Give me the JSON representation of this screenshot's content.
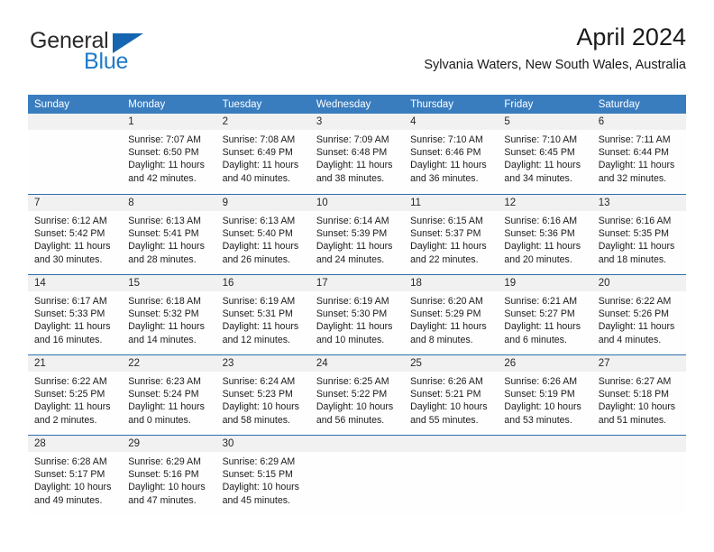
{
  "brand": {
    "name_top": "General",
    "name_bottom": "Blue",
    "triangle_color": "#1565b0",
    "blue_text_color": "#1f79c9"
  },
  "header": {
    "title": "April 2024",
    "subtitle": "Sylvania Waters, New South Wales, Australia",
    "header_bg_color": "#3a7dbf",
    "header_text_color": "#ffffff",
    "daynum_band_color": "#f1f1f1",
    "row_divider_color": "#2f6fae"
  },
  "weekdays": [
    "Sunday",
    "Monday",
    "Tuesday",
    "Wednesday",
    "Thursday",
    "Friday",
    "Saturday"
  ],
  "weeks": [
    [
      {
        "day": "",
        "lines": []
      },
      {
        "day": "1",
        "lines": [
          "Sunrise: 7:07 AM",
          "Sunset: 6:50 PM",
          "Daylight: 11 hours",
          "and 42 minutes."
        ]
      },
      {
        "day": "2",
        "lines": [
          "Sunrise: 7:08 AM",
          "Sunset: 6:49 PM",
          "Daylight: 11 hours",
          "and 40 minutes."
        ]
      },
      {
        "day": "3",
        "lines": [
          "Sunrise: 7:09 AM",
          "Sunset: 6:48 PM",
          "Daylight: 11 hours",
          "and 38 minutes."
        ]
      },
      {
        "day": "4",
        "lines": [
          "Sunrise: 7:10 AM",
          "Sunset: 6:46 PM",
          "Daylight: 11 hours",
          "and 36 minutes."
        ]
      },
      {
        "day": "5",
        "lines": [
          "Sunrise: 7:10 AM",
          "Sunset: 6:45 PM",
          "Daylight: 11 hours",
          "and 34 minutes."
        ]
      },
      {
        "day": "6",
        "lines": [
          "Sunrise: 7:11 AM",
          "Sunset: 6:44 PM",
          "Daylight: 11 hours",
          "and 32 minutes."
        ]
      }
    ],
    [
      {
        "day": "7",
        "lines": [
          "Sunrise: 6:12 AM",
          "Sunset: 5:42 PM",
          "Daylight: 11 hours",
          "and 30 minutes."
        ]
      },
      {
        "day": "8",
        "lines": [
          "Sunrise: 6:13 AM",
          "Sunset: 5:41 PM",
          "Daylight: 11 hours",
          "and 28 minutes."
        ]
      },
      {
        "day": "9",
        "lines": [
          "Sunrise: 6:13 AM",
          "Sunset: 5:40 PM",
          "Daylight: 11 hours",
          "and 26 minutes."
        ]
      },
      {
        "day": "10",
        "lines": [
          "Sunrise: 6:14 AM",
          "Sunset: 5:39 PM",
          "Daylight: 11 hours",
          "and 24 minutes."
        ]
      },
      {
        "day": "11",
        "lines": [
          "Sunrise: 6:15 AM",
          "Sunset: 5:37 PM",
          "Daylight: 11 hours",
          "and 22 minutes."
        ]
      },
      {
        "day": "12",
        "lines": [
          "Sunrise: 6:16 AM",
          "Sunset: 5:36 PM",
          "Daylight: 11 hours",
          "and 20 minutes."
        ]
      },
      {
        "day": "13",
        "lines": [
          "Sunrise: 6:16 AM",
          "Sunset: 5:35 PM",
          "Daylight: 11 hours",
          "and 18 minutes."
        ]
      }
    ],
    [
      {
        "day": "14",
        "lines": [
          "Sunrise: 6:17 AM",
          "Sunset: 5:33 PM",
          "Daylight: 11 hours",
          "and 16 minutes."
        ]
      },
      {
        "day": "15",
        "lines": [
          "Sunrise: 6:18 AM",
          "Sunset: 5:32 PM",
          "Daylight: 11 hours",
          "and 14 minutes."
        ]
      },
      {
        "day": "16",
        "lines": [
          "Sunrise: 6:19 AM",
          "Sunset: 5:31 PM",
          "Daylight: 11 hours",
          "and 12 minutes."
        ]
      },
      {
        "day": "17",
        "lines": [
          "Sunrise: 6:19 AM",
          "Sunset: 5:30 PM",
          "Daylight: 11 hours",
          "and 10 minutes."
        ]
      },
      {
        "day": "18",
        "lines": [
          "Sunrise: 6:20 AM",
          "Sunset: 5:29 PM",
          "Daylight: 11 hours",
          "and 8 minutes."
        ]
      },
      {
        "day": "19",
        "lines": [
          "Sunrise: 6:21 AM",
          "Sunset: 5:27 PM",
          "Daylight: 11 hours",
          "and 6 minutes."
        ]
      },
      {
        "day": "20",
        "lines": [
          "Sunrise: 6:22 AM",
          "Sunset: 5:26 PM",
          "Daylight: 11 hours",
          "and 4 minutes."
        ]
      }
    ],
    [
      {
        "day": "21",
        "lines": [
          "Sunrise: 6:22 AM",
          "Sunset: 5:25 PM",
          "Daylight: 11 hours",
          "and 2 minutes."
        ]
      },
      {
        "day": "22",
        "lines": [
          "Sunrise: 6:23 AM",
          "Sunset: 5:24 PM",
          "Daylight: 11 hours",
          "and 0 minutes."
        ]
      },
      {
        "day": "23",
        "lines": [
          "Sunrise: 6:24 AM",
          "Sunset: 5:23 PM",
          "Daylight: 10 hours",
          "and 58 minutes."
        ]
      },
      {
        "day": "24",
        "lines": [
          "Sunrise: 6:25 AM",
          "Sunset: 5:22 PM",
          "Daylight: 10 hours",
          "and 56 minutes."
        ]
      },
      {
        "day": "25",
        "lines": [
          "Sunrise: 6:26 AM",
          "Sunset: 5:21 PM",
          "Daylight: 10 hours",
          "and 55 minutes."
        ]
      },
      {
        "day": "26",
        "lines": [
          "Sunrise: 6:26 AM",
          "Sunset: 5:19 PM",
          "Daylight: 10 hours",
          "and 53 minutes."
        ]
      },
      {
        "day": "27",
        "lines": [
          "Sunrise: 6:27 AM",
          "Sunset: 5:18 PM",
          "Daylight: 10 hours",
          "and 51 minutes."
        ]
      }
    ],
    [
      {
        "day": "28",
        "lines": [
          "Sunrise: 6:28 AM",
          "Sunset: 5:17 PM",
          "Daylight: 10 hours",
          "and 49 minutes."
        ]
      },
      {
        "day": "29",
        "lines": [
          "Sunrise: 6:29 AM",
          "Sunset: 5:16 PM",
          "Daylight: 10 hours",
          "and 47 minutes."
        ]
      },
      {
        "day": "30",
        "lines": [
          "Sunrise: 6:29 AM",
          "Sunset: 5:15 PM",
          "Daylight: 10 hours",
          "and 45 minutes."
        ]
      },
      {
        "day": "",
        "lines": []
      },
      {
        "day": "",
        "lines": []
      },
      {
        "day": "",
        "lines": []
      },
      {
        "day": "",
        "lines": []
      }
    ]
  ]
}
